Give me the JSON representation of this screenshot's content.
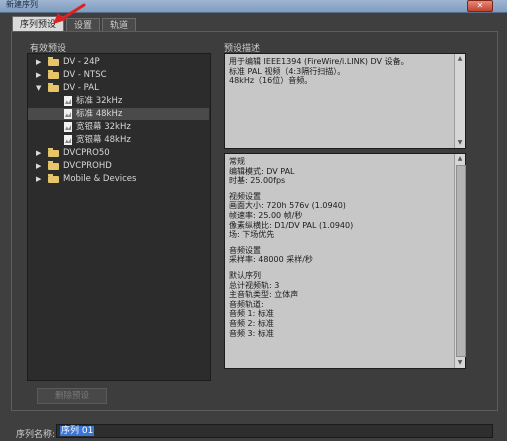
{
  "window": {
    "title": "新建序列",
    "close_icon": "close-icon"
  },
  "tabs": [
    {
      "label": "序列预设",
      "active": true
    },
    {
      "label": "设置",
      "active": false
    },
    {
      "label": "轨道",
      "active": false
    }
  ],
  "presets": {
    "label": "有效预设",
    "items": [
      {
        "label": "DV - 24P",
        "type": "folder",
        "expanded": false,
        "selected": false,
        "level": 0
      },
      {
        "label": "DV - NTSC",
        "type": "folder",
        "expanded": false,
        "selected": false,
        "level": 0
      },
      {
        "label": "DV - PAL",
        "type": "folder",
        "expanded": true,
        "selected": false,
        "level": 0
      },
      {
        "label": "标准 32kHz",
        "type": "file",
        "selected": false,
        "level": 1
      },
      {
        "label": "标准 48kHz",
        "type": "file",
        "selected": true,
        "level": 1
      },
      {
        "label": "宽银幕 32kHz",
        "type": "file",
        "selected": false,
        "level": 1
      },
      {
        "label": "宽银幕 48kHz",
        "type": "file",
        "selected": false,
        "level": 1
      },
      {
        "label": "DVCPRO50",
        "type": "folder",
        "expanded": false,
        "selected": false,
        "level": 0
      },
      {
        "label": "DVCPROHD",
        "type": "folder",
        "expanded": false,
        "selected": false,
        "level": 0
      },
      {
        "label": "Mobile & Devices",
        "type": "folder",
        "expanded": false,
        "selected": false,
        "level": 0
      }
    ]
  },
  "description": {
    "label": "预设描述",
    "lines": [
      "用于编辑 IEEE1394 (FireWire/i.LINK) DV 设备。",
      "标准 PAL 视频（4:3隔行扫描）。",
      "48kHz（16位）音频。"
    ]
  },
  "general_info": {
    "lines": [
      "常规",
      " 编辑模式: DV PAL",
      " 时基: 25.00fps",
      "",
      "视频设置",
      " 画面大小: 720h 576v (1.0940)",
      " 帧速率: 25.00 帧/秒",
      " 像素纵横比: D1/DV PAL (1.0940)",
      " 场: 下场优先",
      "",
      "音频设置",
      " 采样率: 48000 采样/秒",
      "",
      "默认序列",
      " 总计视频轨: 3",
      " 主音轨类型: 立体声",
      " 音频轨道:",
      " 音频 1: 标准",
      " 音频 2: 标准",
      " 音频 3: 标准"
    ]
  },
  "buttons": {
    "delete_preset": "删除预设"
  },
  "sequence_name": {
    "label": "序列名称:",
    "value": "序列 01"
  },
  "colors": {
    "accent_red": "#e02020",
    "selection_blue": "#3a76d6",
    "folder": "#e6c46a"
  }
}
